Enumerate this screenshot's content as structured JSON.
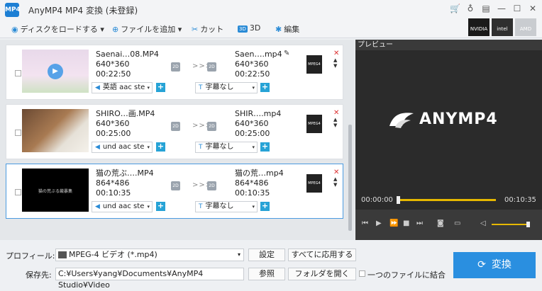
{
  "app": {
    "title": "AnyMP4 MP4 変換 (未登録)",
    "logo_text": "MP4"
  },
  "window_icons": [
    "cart-icon",
    "key-icon",
    "chat-icon",
    "minimize-icon",
    "maximize-icon",
    "close-icon"
  ],
  "window_glyphs": [
    "🛒",
    "♁",
    "▤",
    "—",
    "☐",
    "✕"
  ],
  "toolbar": {
    "load_disc": "ディスクをロードする",
    "add_file": "ファイルを追加",
    "cut": "カット",
    "three_d_badge": "3D",
    "three_d": "3D",
    "edit": "編集"
  },
  "gpu": {
    "nvidia": "NVIDIA",
    "intel": "intel",
    "amd": "AMD"
  },
  "files": [
    {
      "src_name": "Saenai…08.MP4",
      "src_res": "640*360",
      "src_dur": "00:22:50",
      "dst_name": "Saen….mp4",
      "dst_res": "640*360",
      "dst_dur": "00:22:50",
      "audio": "英語 aac ste",
      "subtitle": "字幕なし",
      "thumb_caption": ""
    },
    {
      "src_name": "SHIRO…画.MP4",
      "src_res": "640*360",
      "src_dur": "00:25:00",
      "dst_name": "SHIR….mp4",
      "dst_res": "640*360",
      "dst_dur": "00:25:00",
      "audio": "und aac ste",
      "subtitle": "字幕なし",
      "thumb_caption": ""
    },
    {
      "src_name": "猫の荒ぶ….MP4",
      "src_res": "864*486",
      "src_dur": "00:10:35",
      "dst_name": "猫の荒…mp4",
      "dst_res": "864*486",
      "dst_dur": "00:10:35",
      "audio": "und aac ste",
      "subtitle": "字幕なし",
      "thumb_caption": "猫の荒ぶる厳暴集"
    }
  ],
  "labels": {
    "badge_2d": "2D",
    "arrows": ">>>",
    "format_label": "MPEG4",
    "delete": "✕",
    "updown": "▲\n▼",
    "plus": "+",
    "audio_prefix": "◀",
    "subtitle_prefix": "T",
    "pencil": "✎"
  },
  "preview": {
    "header": "プレビュー",
    "brand": "ANYMP4",
    "time_current": "00:00:00",
    "time_total": "00:10:35",
    "seek_progress": 0.0,
    "volume_level": 0.95
  },
  "bottom": {
    "profile_label": "プロフィール:",
    "profile_value": "MPEG-4 ビデオ (*.mp4)",
    "settings": "設定",
    "apply_all": "すべてに応用する",
    "save_label": "保存先:",
    "save_path": "C:¥Users¥yang¥Documents¥AnyMP4 Studio¥Video",
    "browse": "参照",
    "open_folder": "フォルダを開く",
    "merge_label": "一つのファイルに結合",
    "convert": "変換"
  },
  "colors": {
    "accent": "#2a8fe0",
    "seek": "#e6b800",
    "delete": "#dd3333"
  }
}
